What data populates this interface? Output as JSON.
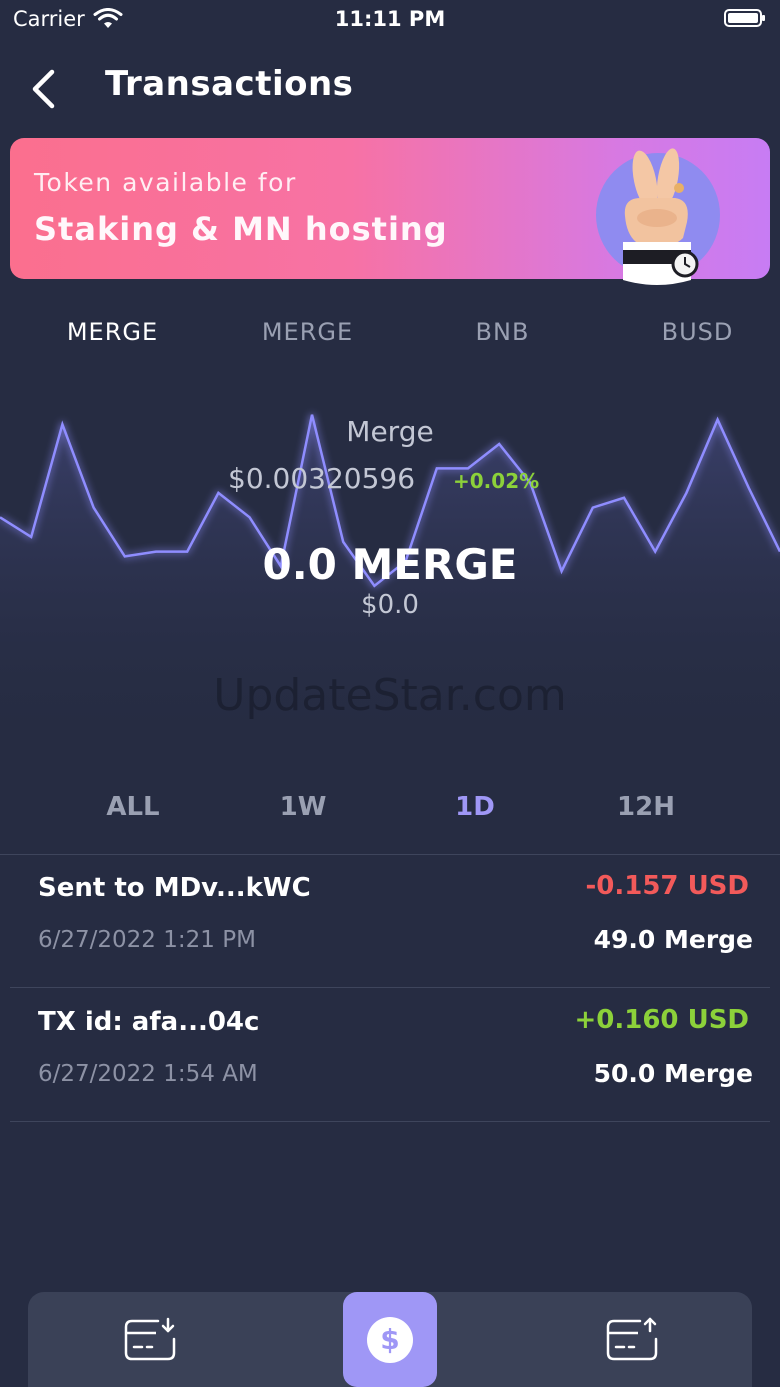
{
  "status_bar": {
    "carrier": "Carrier",
    "time": "11:11 PM"
  },
  "header": {
    "title": "Transactions"
  },
  "promo": {
    "line1": "Token available for",
    "line2": "Staking & MN hosting"
  },
  "token_tabs": [
    {
      "label": "MERGE",
      "active": true
    },
    {
      "label": "MERGE",
      "active": false
    },
    {
      "label": "BNB",
      "active": false
    },
    {
      "label": "BUSD",
      "active": false
    }
  ],
  "coin": {
    "name": "Merge",
    "price": "$0.00320596",
    "change": "+0.02%",
    "balance": "0.0 MERGE",
    "balance_usd": "$0.0"
  },
  "chart_data": {
    "type": "line",
    "series": [
      {
        "values": [
          46,
          42,
          65,
          48,
          38,
          39,
          39,
          51,
          46,
          36,
          67,
          41,
          32,
          37,
          56,
          56,
          61,
          53,
          35,
          48,
          50,
          39,
          51,
          66,
          52,
          39
        ]
      }
    ],
    "color": "#8f8dff"
  },
  "watermark": "UpdateStar.com",
  "range_tabs": [
    {
      "label": "ALL",
      "active": false
    },
    {
      "label": "1W",
      "active": false
    },
    {
      "label": "1D",
      "active": true
    },
    {
      "label": "12H",
      "active": false
    }
  ],
  "transactions": [
    {
      "title": "Sent to MDv...kWC",
      "date": "6/27/2022 1:21 PM",
      "usd": "-0.157 USD",
      "amount": "49.0 Merge",
      "direction": "out"
    },
    {
      "title": "TX id: afa...04c",
      "date": "6/27/2022 1:54 AM",
      "usd": "+0.160 USD",
      "amount": "50.0 Merge",
      "direction": "in"
    }
  ],
  "bottom_nav": [
    {
      "icon": "receive-icon"
    },
    {
      "icon": "dollar-icon",
      "active": true
    },
    {
      "icon": "send-icon"
    }
  ],
  "colors": {
    "background": "#262c42",
    "accent": "#9f97f6",
    "positive": "#8cd13a",
    "negative": "#f25a5a"
  }
}
